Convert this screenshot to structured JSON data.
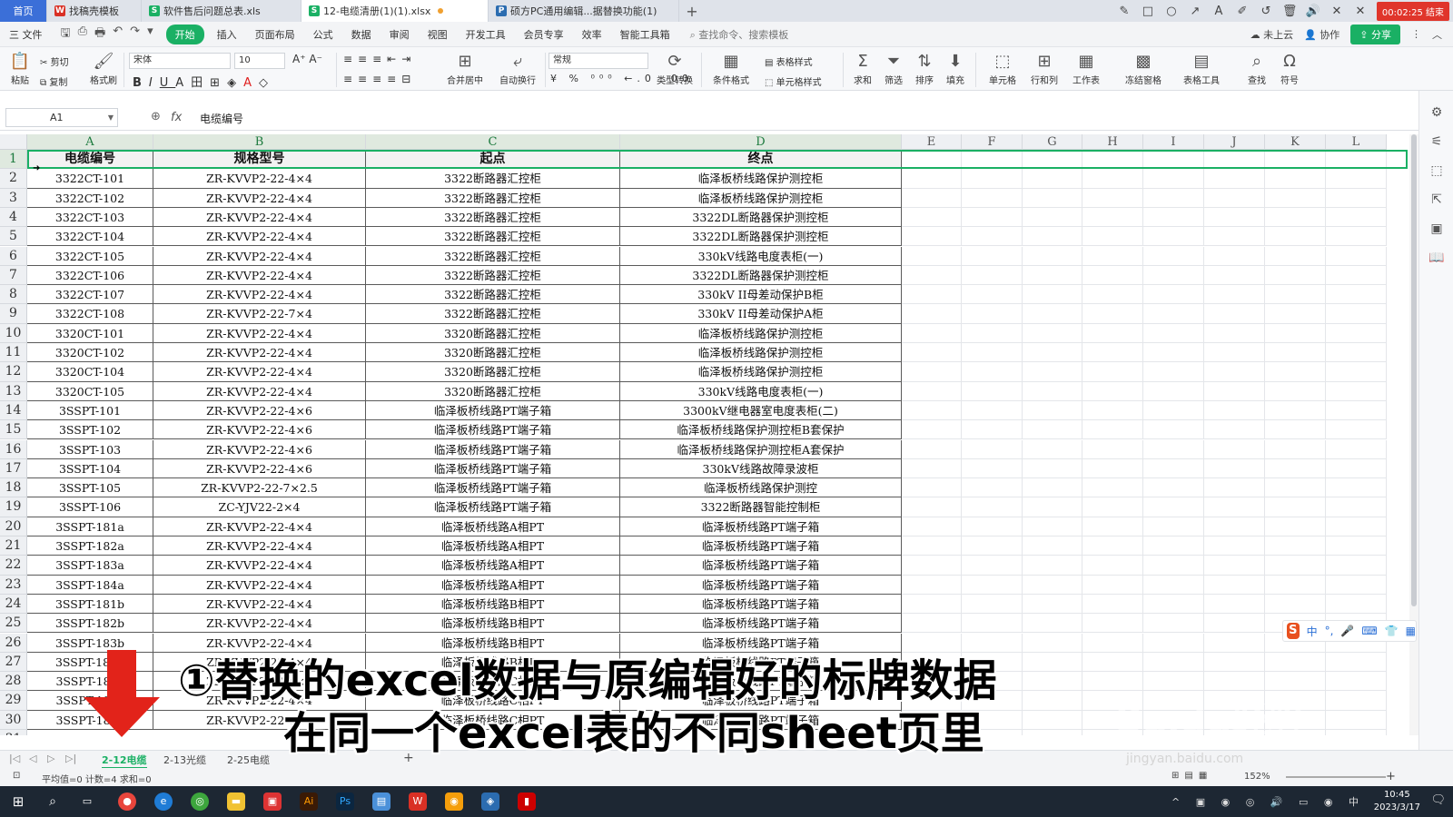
{
  "tabs": [
    {
      "label": "首页",
      "kind": "home"
    },
    {
      "label": "找稿壳模板",
      "kind": "doc"
    },
    {
      "label": "软件售后问题总表.xls",
      "kind": "sheet"
    },
    {
      "label": "12-电缆清册(1)(1).xlsx",
      "kind": "sheet",
      "active": true
    },
    {
      "label": "硕方PC通用编辑...据替换功能(1)",
      "kind": "web"
    }
  ],
  "new_tab_label": "+",
  "timer": "00:02:25 结束",
  "menu": {
    "file": "三 文件",
    "items": [
      "开始",
      "插入",
      "页面布局",
      "公式",
      "数据",
      "审阅",
      "视图",
      "开发工具",
      "会员专享",
      "效率",
      "智能工具箱"
    ],
    "active": "开始",
    "search": "查找命令、搜索模板",
    "right": [
      "未上云",
      "协作"
    ],
    "share": "分享"
  },
  "ribbon": {
    "paste": "粘贴",
    "cut": "剪切",
    "copy": "复制",
    "format_painter": "格式刷",
    "font_name": "宋体",
    "font_size": "10",
    "merge": "合并居中",
    "wrap": "自动换行",
    "number_format": "常规",
    "type_convert": "类型转换",
    "cond_format": "条件格式",
    "table_style": "表格样式",
    "cell_style": "单元格样式",
    "sum": "求和",
    "filter": "筛选",
    "sort": "排序",
    "fill": "填充",
    "cell": "单元格",
    "rowcol": "行和列",
    "worksheet": "工作表",
    "freeze": "冻结窗格",
    "table_tools": "表格工具",
    "find": "查找",
    "symbol": "符号"
  },
  "formula_bar": {
    "cell_ref": "A1",
    "fx": "fx",
    "value": "电缆编号"
  },
  "columns": [
    "A",
    "B",
    "C",
    "D",
    "E",
    "F",
    "G",
    "H",
    "I",
    "J",
    "K",
    "L"
  ],
  "headers": [
    "电缆编号",
    "规格型号",
    "起点",
    "终点"
  ],
  "rows": [
    [
      "3322CT-101",
      "ZR-KVVP2-22-4×4",
      "3322断路器汇控柜",
      "临泽板桥线路保护测控柜"
    ],
    [
      "3322CT-102",
      "ZR-KVVP2-22-4×4",
      "3322断路器汇控柜",
      "临泽板桥线路保护测控柜"
    ],
    [
      "3322CT-103",
      "ZR-KVVP2-22-4×4",
      "3322断路器汇控柜",
      "3322DL断路器保护测控柜"
    ],
    [
      "3322CT-104",
      "ZR-KVVP2-22-4×4",
      "3322断路器汇控柜",
      "3322DL断路器保护测控柜"
    ],
    [
      "3322CT-105",
      "ZR-KVVP2-22-4×4",
      "3322断路器汇控柜",
      "330kV线路电度表柜(一)"
    ],
    [
      "3322CT-106",
      "ZR-KVVP2-22-4×4",
      "3322断路器汇控柜",
      "3322DL断路器保护测控柜"
    ],
    [
      "3322CT-107",
      "ZR-KVVP2-22-4×4",
      "3322断路器汇控柜",
      "330kV II母差动保护B柜"
    ],
    [
      "3322CT-108",
      "ZR-KVVP2-22-7×4",
      "3322断路器汇控柜",
      "330kV II母差动保护A柜"
    ],
    [
      "3320CT-101",
      "ZR-KVVP2-22-4×4",
      "3320断路器汇控柜",
      "临泽板桥线路保护测控柜"
    ],
    [
      "3320CT-102",
      "ZR-KVVP2-22-4×4",
      "3320断路器汇控柜",
      "临泽板桥线路保护测控柜"
    ],
    [
      "3320CT-104",
      "ZR-KVVP2-22-4×4",
      "3320断路器汇控柜",
      "临泽板桥线路保护测控柜"
    ],
    [
      "3320CT-105",
      "ZR-KVVP2-22-4×4",
      "3320断路器汇控柜",
      "330kV线路电度表柜(一)"
    ],
    [
      "3SSPT-101",
      "ZR-KVVP2-22-4×6",
      "临泽板桥线路PT端子箱",
      "3300kV继电器室电度表柜(二)"
    ],
    [
      "3SSPT-102",
      "ZR-KVVP2-22-4×6",
      "临泽板桥线路PT端子箱",
      "临泽板桥线路保护测控柜B套保护"
    ],
    [
      "3SSPT-103",
      "ZR-KVVP2-22-4×6",
      "临泽板桥线路PT端子箱",
      "临泽板桥线路保护测控柜A套保护"
    ],
    [
      "3SSPT-104",
      "ZR-KVVP2-22-4×6",
      "临泽板桥线路PT端子箱",
      "330kV线路故障录波柜"
    ],
    [
      "3SSPT-105",
      "ZR-KVVP2-22-7×2.5",
      "临泽板桥线路PT端子箱",
      "临泽板桥线路保护测控"
    ],
    [
      "3SSPT-106",
      "ZC-YJV22-2×4",
      "临泽板桥线路PT端子箱",
      "3322断路器智能控制柜"
    ],
    [
      "3SSPT-181a",
      "ZR-KVVP2-22-4×4",
      "临泽板桥线路A相PT",
      "临泽板桥线路PT端子箱"
    ],
    [
      "3SSPT-182a",
      "ZR-KVVP2-22-4×4",
      "临泽板桥线路A相PT",
      "临泽板桥线路PT端子箱"
    ],
    [
      "3SSPT-183a",
      "ZR-KVVP2-22-4×4",
      "临泽板桥线路A相PT",
      "临泽板桥线路PT端子箱"
    ],
    [
      "3SSPT-184a",
      "ZR-KVVP2-22-4×4",
      "临泽板桥线路A相PT",
      "临泽板桥线路PT端子箱"
    ],
    [
      "3SSPT-181b",
      "ZR-KVVP2-22-4×4",
      "临泽板桥线路B相PT",
      "临泽板桥线路PT端子箱"
    ],
    [
      "3SSPT-182b",
      "ZR-KVVP2-22-4×4",
      "临泽板桥线路B相PT",
      "临泽板桥线路PT端子箱"
    ],
    [
      "3SSPT-183b",
      "ZR-KVVP2-22-4×4",
      "临泽板桥线路B相PT",
      "临泽板桥线路PT端子箱"
    ],
    [
      "3SSPT-184b",
      "ZR-KVVP2-22-4×4",
      "临泽板桥线路B相PT",
      "临泽板桥线路PT端子箱"
    ],
    [
      "3SSPT-181c",
      "ZR-KVVP2-22-4×4",
      "临泽板桥线路C相PT",
      "临泽板桥线路PT端子箱"
    ],
    [
      "3SSPT-182c",
      "ZR-KVVP2-22-4×4",
      "临泽板桥线路C相PT",
      "临泽板桥线路PT端子箱"
    ],
    [
      "3SSPT-183c",
      "ZR-KVVP2-22-4×4",
      "临泽板桥线路C相PT",
      "临泽板桥线路PT端子箱"
    ]
  ],
  "sheet_tabs": [
    "2-12电缆",
    "2-13光缆",
    "2-25电缆"
  ],
  "active_sheet": "2-12电缆",
  "add_sheet": "+",
  "status": "平均值=0  计数=4  求和=0",
  "zoom": "152%",
  "clock": {
    "time": "10:45",
    "date": "2023/3/17"
  },
  "ime": {
    "mode": "中"
  },
  "caption": {
    "line1": "①替换的excel数据与原编辑好的标牌数据",
    "line2": "在同一个excel表的不同sheet页里"
  },
  "watermark": {
    "text": "Baidu经验",
    "url": "jingyan.baidu.com"
  },
  "colors": {
    "accent": "#1ab064",
    "home_tab": "#3b6fd8",
    "timer": "#e0352b",
    "arrow": "#e2231a"
  }
}
